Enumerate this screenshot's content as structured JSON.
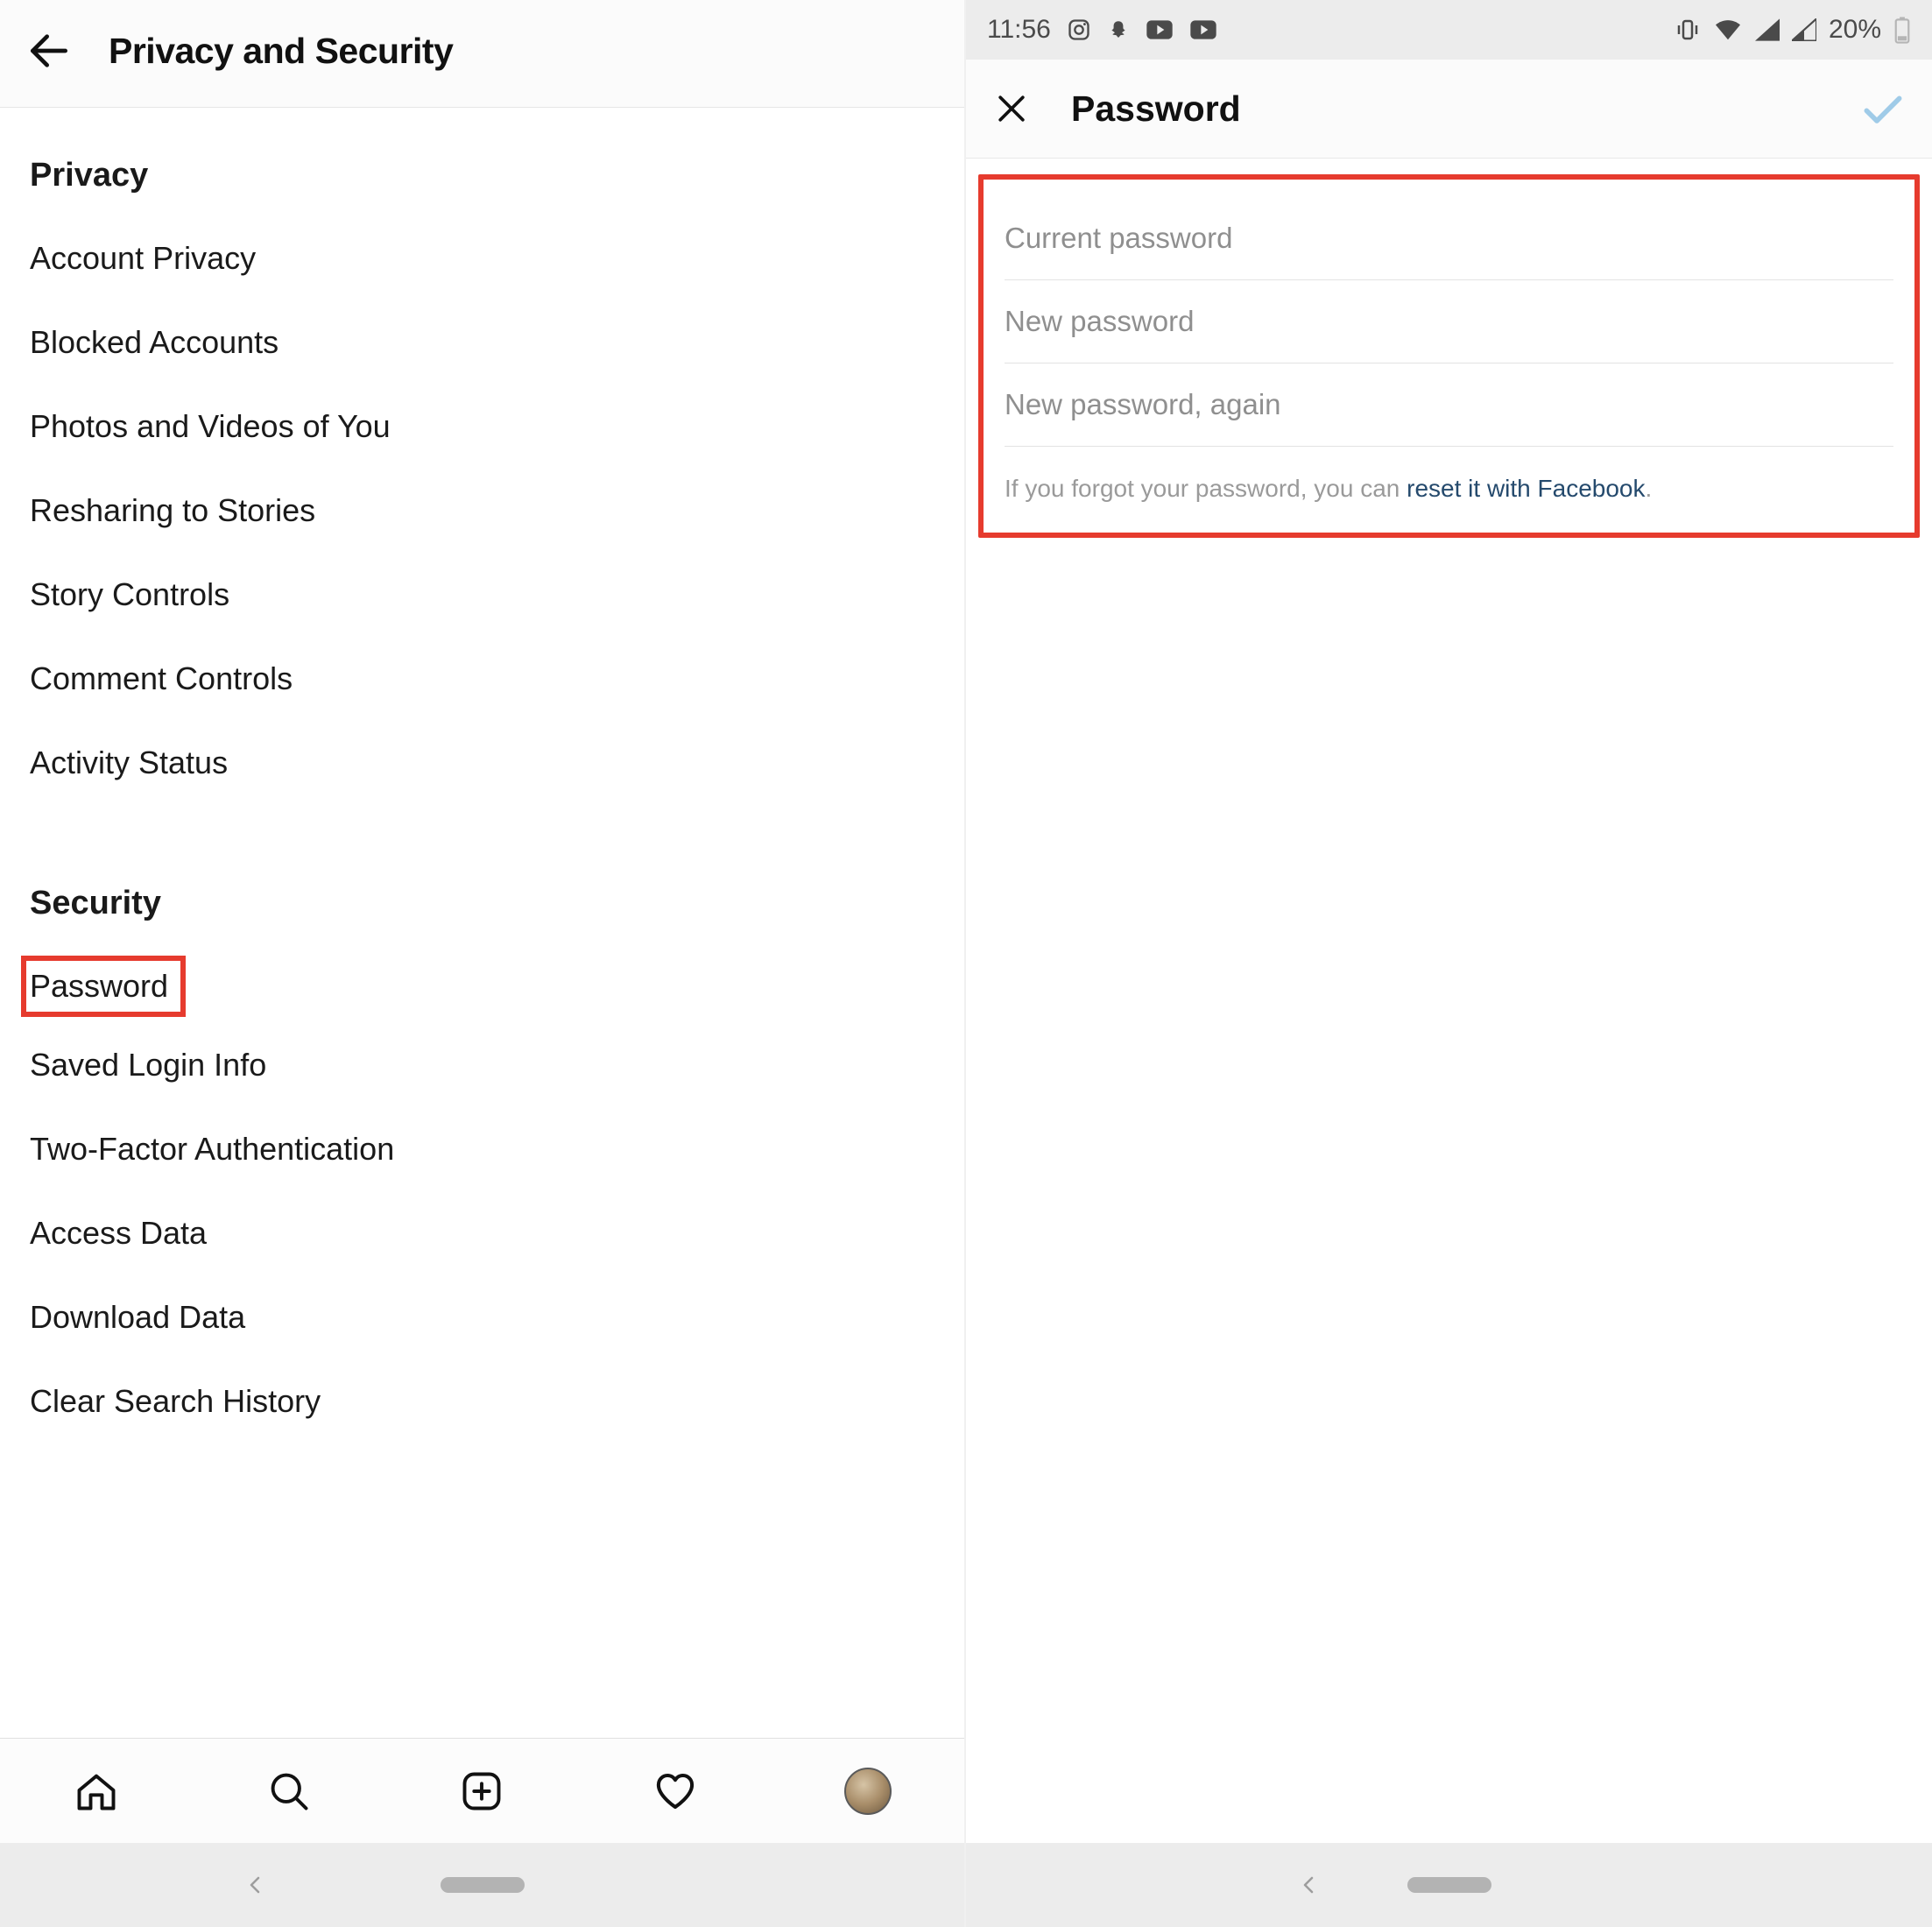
{
  "left": {
    "header": {
      "title": "Privacy and Security"
    },
    "sections": {
      "privacy": {
        "title": "Privacy",
        "items": [
          "Account Privacy",
          "Blocked Accounts",
          "Photos and Videos of You",
          "Resharing to Stories",
          "Story Controls",
          "Comment Controls",
          "Activity Status"
        ]
      },
      "security": {
        "title": "Security",
        "items": [
          "Password",
          "Saved Login Info",
          "Two-Factor Authentication",
          "Access Data",
          "Download Data",
          "Clear Search History"
        ]
      }
    }
  },
  "right": {
    "status": {
      "time": "11:56",
      "battery_pct": "20%"
    },
    "header": {
      "title": "Password"
    },
    "form": {
      "current_placeholder": "Current password",
      "new_placeholder": "New password",
      "again_placeholder": "New password, again",
      "helper_prefix": "If you forgot your password, you can ",
      "helper_link": "reset it with Facebook",
      "helper_suffix": "."
    }
  }
}
